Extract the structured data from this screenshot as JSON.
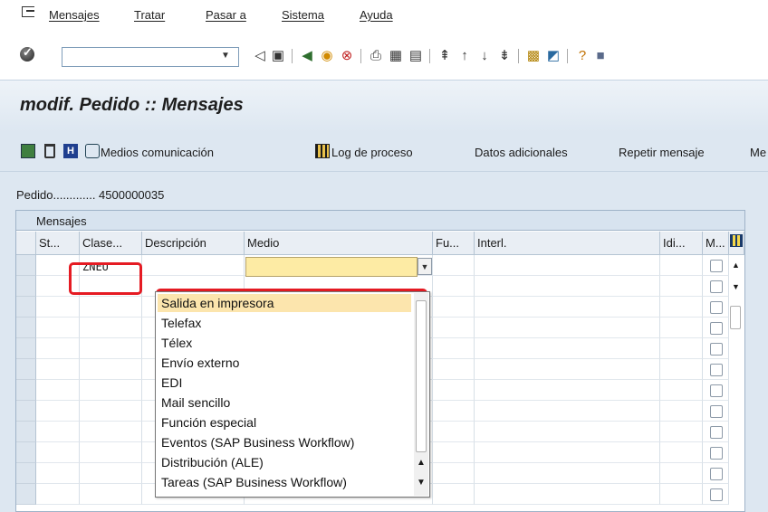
{
  "menubar": {
    "items": [
      "Mensajes",
      "Tratar",
      "Pasar a",
      "Sistema",
      "Ayuda"
    ]
  },
  "toolbar": {
    "command_value": ""
  },
  "title": "modif. Pedido :: Mensajes",
  "app_toolbar": {
    "medios": "Medios comunicación",
    "log": "Log de proceso",
    "datos": "Datos adicionales",
    "repetir": "Repetir mensaje",
    "more": "Me"
  },
  "pedido": "Pedido............. 4500000035",
  "panel": {
    "title": "Mensajes",
    "columns": [
      "St...",
      "Clase...",
      "Descripción",
      "Medio",
      "Fu...",
      "Interl.",
      "Idi...",
      "M..."
    ],
    "row1_clase": "ZNEU"
  },
  "dropdown": {
    "options": [
      "Salida en impresora",
      "Telefax",
      "Télex",
      "Envío externo",
      "EDI",
      "Mail sencillo",
      "Función especial",
      "Eventos (SAP Business Workflow)",
      "Distribución (ALE)",
      "Tareas (SAP Business Workflow)"
    ],
    "selected": "Salida en impresora"
  },
  "colors": {
    "highlight": "#e51b23",
    "selected_bg": "#fce5ad",
    "field_bg": "#fdeba4"
  }
}
